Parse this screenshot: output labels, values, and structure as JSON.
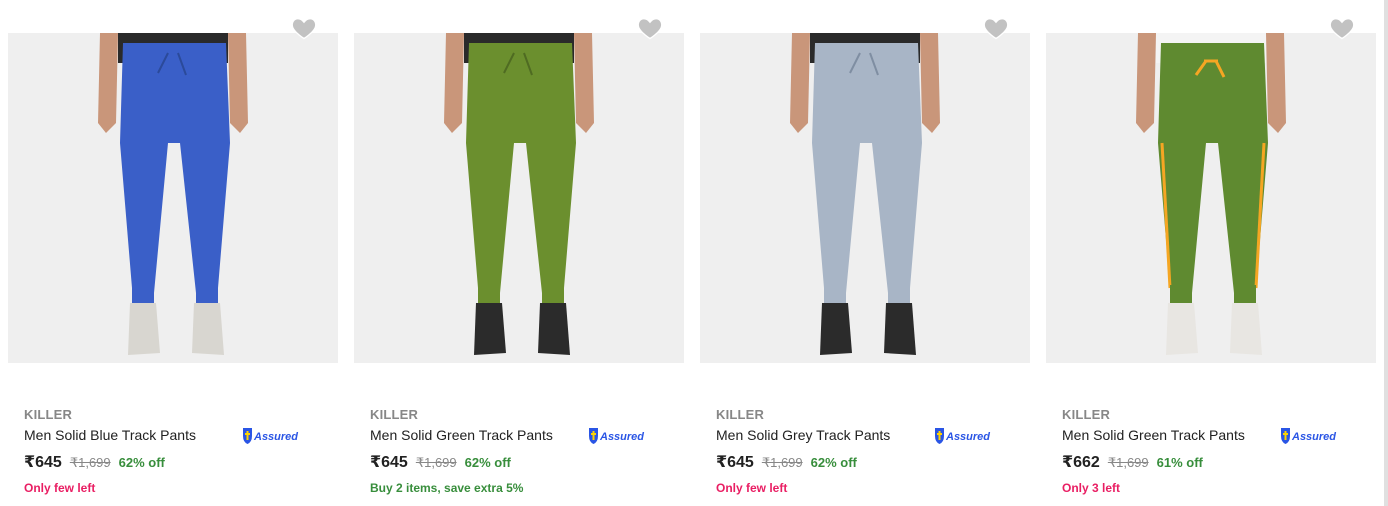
{
  "products": [
    {
      "brand": "KILLER",
      "title": "Men Solid Blue Track Pants",
      "price": "₹645",
      "mrp": "₹1,699",
      "discount": "62% off",
      "note": "Only few left",
      "note_color": "#e91e63",
      "pant_color": "#3a5fc8",
      "shoe_color": "#d8d6d0",
      "assured": "Assured"
    },
    {
      "brand": "KILLER",
      "title": "Men Solid Green Track Pants",
      "price": "₹645",
      "mrp": "₹1,699",
      "discount": "62% off",
      "note": "Buy 2 items, save extra 5%",
      "note_color": "#388e3c",
      "pant_color": "#6b8f2e",
      "shoe_color": "#2b2b2b",
      "assured": "Assured"
    },
    {
      "brand": "KILLER",
      "title": "Men Solid Grey Track Pants",
      "price": "₹645",
      "mrp": "₹1,699",
      "discount": "62% off",
      "note": "Only few left",
      "note_color": "#e91e63",
      "pant_color": "#a8b5c6",
      "shoe_color": "#2b2b2b",
      "assured": "Assured"
    },
    {
      "brand": "KILLER",
      "title": "Men Solid Green Track Pants",
      "price": "₹662",
      "mrp": "₹1,699",
      "discount": "61% off",
      "note": "Only 3 left",
      "note_color": "#e91e63",
      "pant_color": "#5f8a30",
      "shoe_color": "#e8e6e2",
      "assured": "Assured"
    }
  ]
}
